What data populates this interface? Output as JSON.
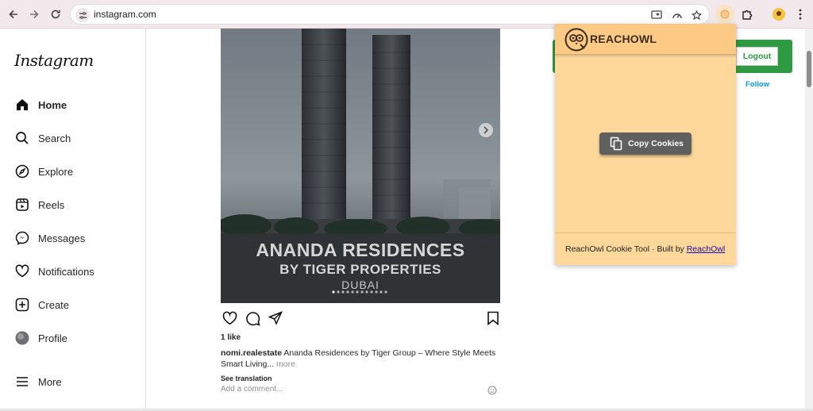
{
  "browser": {
    "url": "instagram.com",
    "icons": [
      "back-arrow-icon",
      "forward-arrow-icon",
      "reload-icon",
      "site-info-icon",
      "cast-icon",
      "performance-icon",
      "star-icon",
      "reachowl-extension-icon",
      "puzzle-icon",
      "profile-avatar-icon",
      "kebab-menu-icon"
    ]
  },
  "instagram": {
    "logo": "Instagram",
    "nav": [
      {
        "label": "Home",
        "icon": "home-icon"
      },
      {
        "label": "Search",
        "icon": "search-icon"
      },
      {
        "label": "Explore",
        "icon": "compass-icon"
      },
      {
        "label": "Reels",
        "icon": "reels-icon"
      },
      {
        "label": "Messages",
        "icon": "messenger-icon"
      },
      {
        "label": "Notifications",
        "icon": "heart-icon"
      },
      {
        "label": "Create",
        "icon": "plus-square-icon"
      },
      {
        "label": "Profile",
        "icon": "avatar-icon"
      },
      {
        "label": "More",
        "icon": "hamburger-icon"
      }
    ],
    "post": {
      "image_text": {
        "line1": "ANANDA RESIDENCES",
        "line2": "BY TIGER PROPERTIES",
        "line3": "DUBAI"
      },
      "likes": "1 like",
      "username": "nomi.realestate",
      "caption": "Ananda Residences by Tiger Group – Where Style Meets Smart Living...",
      "more": "more",
      "see_translation": "See translation",
      "comment_placeholder": "Add a comment..."
    },
    "right": {
      "logout": "Logout",
      "follow": "Follow"
    }
  },
  "popup": {
    "title": "REACHOWL",
    "copy_button": "Copy Cookies",
    "footer_text": "ReachOwl Cookie Tool · Built by ",
    "footer_link": "ReachOwl"
  }
}
